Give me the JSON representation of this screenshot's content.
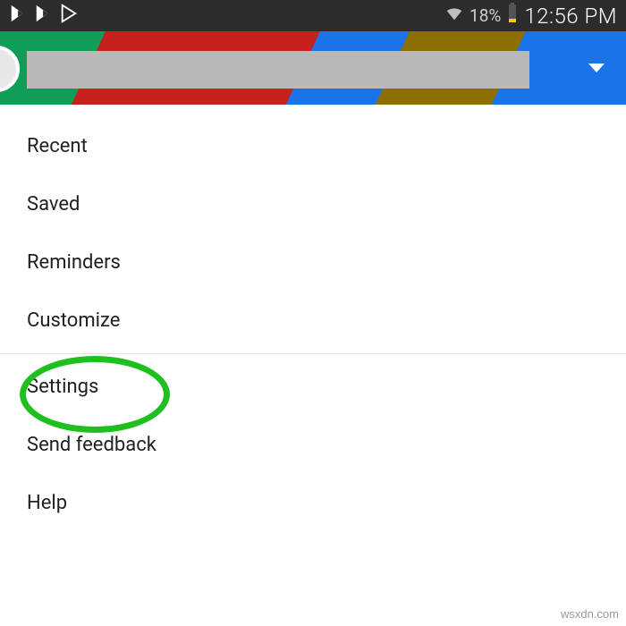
{
  "status": {
    "battery_pct": "18%",
    "time": "12:56 PM"
  },
  "menu": {
    "items": [
      "Recent",
      "Saved",
      "Reminders",
      "Customize",
      "Settings",
      "Send feedback",
      "Help"
    ]
  },
  "watermark": "wsxdn.com",
  "colors": {
    "green": "#0f9d58",
    "red": "#c5221f",
    "blue": "#1a73e8",
    "highlight": "#1fbf1f"
  }
}
